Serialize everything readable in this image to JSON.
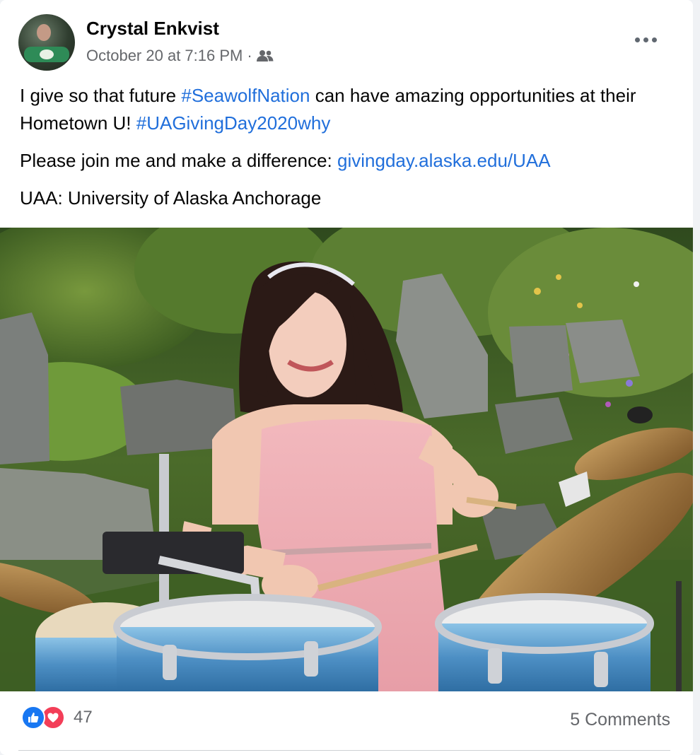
{
  "post": {
    "author_name": "Crystal Enkvist",
    "timestamp": "October 20 at 7:16 PM",
    "meta_separator": "·",
    "audience_icon": "friends-icon",
    "more_icon": "more-options-icon",
    "text": {
      "line1_before": "I give so that future ",
      "hashtag1": "#SeawolfNation",
      "line1_after": " can have amazing opportunities at their Hometown U! ",
      "hashtag2": "#UAGivingDay2020why",
      "line2_before": "Please join me and make a difference: ",
      "link": "givingday.alaska.edu/UAA",
      "line3": "UAA: University of Alaska Anchorage"
    },
    "photo_icon": "post-photo",
    "colors": {
      "link": "#216fdb",
      "like": "#1877f2",
      "love": "#f33e58",
      "muted": "#65676b"
    }
  },
  "footer": {
    "reaction_icons": [
      "like-icon",
      "love-icon"
    ],
    "reaction_count": "47",
    "comments_label": "5 Comments"
  }
}
